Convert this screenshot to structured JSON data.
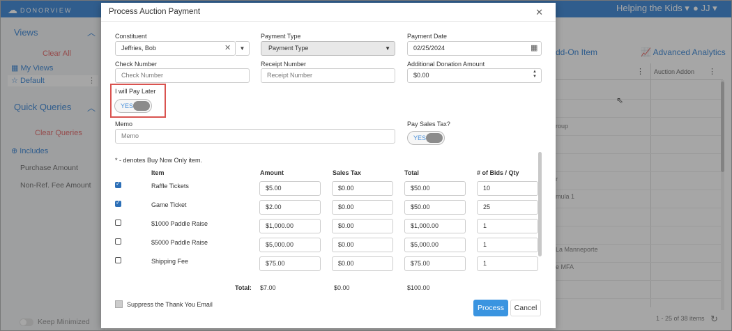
{
  "app": {
    "brand": "DONORVIEW",
    "org_name": "Helping the Kids",
    "user_initials": "JJ"
  },
  "sidebar": {
    "views_heading": "Views",
    "clear_all": "Clear All",
    "my_views": "My Views",
    "default_view": "Default",
    "quick_queries_heading": "Quick Queries",
    "clear_queries": "Clear Queries",
    "includes": "Includes",
    "items": [
      "Purchase Amount",
      "Non-Ref. Fee Amount"
    ],
    "keep_minimized": "Keep Minimized"
  },
  "background_grid": {
    "tab_addon": "dd-On Item",
    "tab_analytics": "Advanced Analytics",
    "column_auction_addon": "Auction Addon",
    "partial_cells": [
      "roup",
      "r",
      "mula 1",
      "La Manneporte",
      "e MFA"
    ],
    "footer": "1 - 25 of 38 items"
  },
  "modal": {
    "title": "Process Auction Payment",
    "constituent_label": "Constituent",
    "constituent_value": "Jeffries, Bob",
    "payment_type_label": "Payment Type",
    "payment_type_value": "Payment Type",
    "payment_date_label": "Payment Date",
    "payment_date_value": "02/25/2024",
    "check_number_label": "Check Number",
    "check_number_placeholder": "Check Number",
    "receipt_number_label": "Receipt Number",
    "receipt_number_placeholder": "Receipt Number",
    "additional_donation_label": "Additional Donation Amount",
    "additional_donation_value": "$0.00",
    "pay_later_label": "I will Pay Later",
    "pay_later_toggle": "YES",
    "memo_label": "Memo",
    "memo_placeholder": "Memo",
    "pay_sales_tax_label": "Pay Sales Tax?",
    "pay_sales_tax_toggle": "YES",
    "buy_now_note": "* - denotes Buy Now Only item.",
    "columns": {
      "item": "Item",
      "amount": "Amount",
      "sales_tax": "Sales Tax",
      "total": "Total",
      "bids_qty": "# of Bids / Qty"
    },
    "rows": [
      {
        "checked": true,
        "item": "Raffle Tickets",
        "amount": "$5.00",
        "sales_tax": "$0.00",
        "total": "$50.00",
        "qty": "10"
      },
      {
        "checked": true,
        "item": "Game Ticket",
        "amount": "$2.00",
        "sales_tax": "$0.00",
        "total": "$50.00",
        "qty": "25"
      },
      {
        "checked": false,
        "item": "$1000 Paddle Raise",
        "amount": "$1,000.00",
        "sales_tax": "$0.00",
        "total": "$1,000.00",
        "qty": "1"
      },
      {
        "checked": false,
        "item": "$5000 Paddle Raise",
        "amount": "$5,000.00",
        "sales_tax": "$0.00",
        "total": "$5,000.00",
        "qty": "1"
      },
      {
        "checked": false,
        "item": "Shipping Fee",
        "amount": "$75.00",
        "sales_tax": "$0.00",
        "total": "$75.00",
        "qty": "1"
      }
    ],
    "totals": {
      "label": "Total:",
      "amount": "$7.00",
      "sales_tax": "$0.00",
      "total": "$100.00"
    },
    "suppress_label": "Suppress the Thank You Email",
    "process_button": "Process",
    "cancel_button": "Cancel"
  },
  "colors": {
    "accent": "#4a90d9",
    "primary_button": "#3a94e0",
    "highlight_box": "#d9534f",
    "clear_link": "#e57373"
  },
  "icons": {
    "close": "close-icon",
    "calendar": "calendar-icon",
    "clear": "clear-icon",
    "dropdown": "chevron-down-icon",
    "spinner": "spinner-arrows-icon",
    "refresh": "refresh-icon"
  }
}
